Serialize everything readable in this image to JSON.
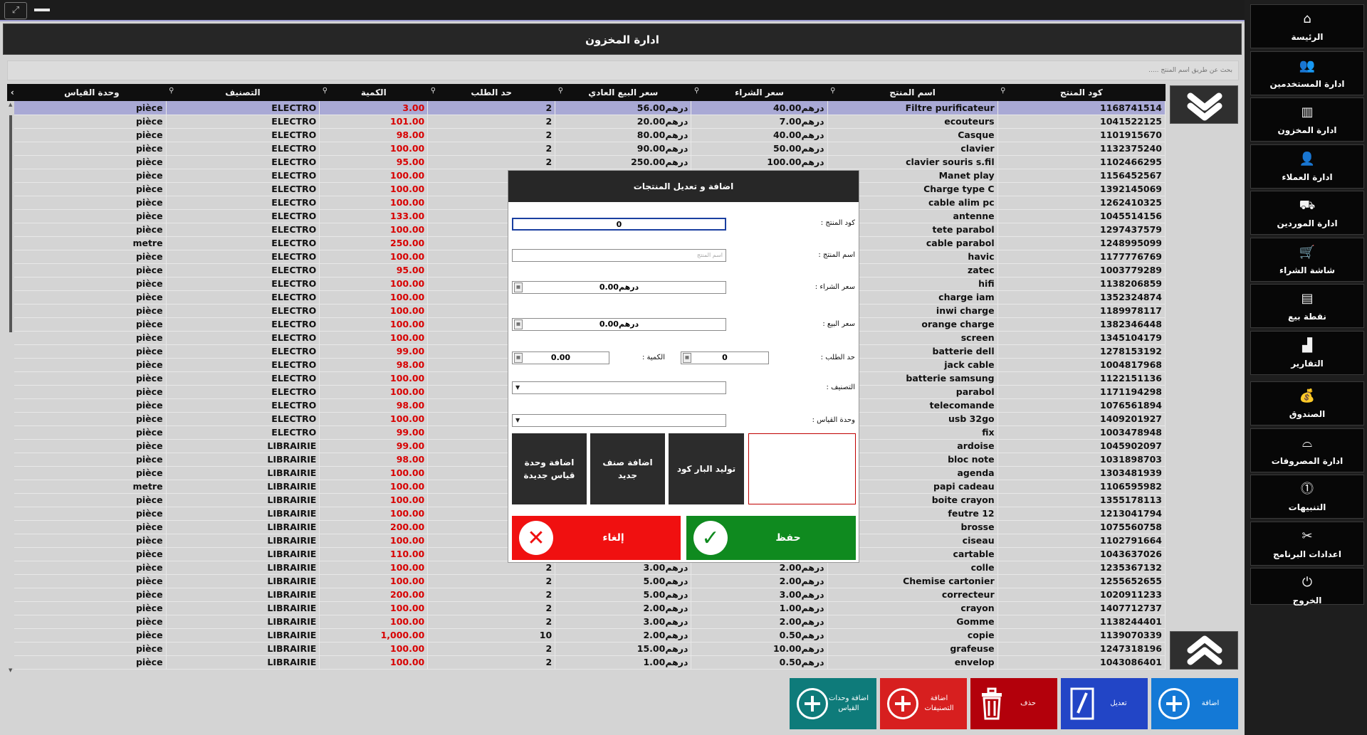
{
  "title": "ادارة المخزون",
  "search": {
    "placeholder": "بحث عن طريق اسم المنتج ....."
  },
  "table": {
    "columns": [
      "كود المنتج",
      "اسم المنتج",
      "سعر الشراء",
      "سعر البيع العادي",
      "حد الطلب",
      "الكمية",
      "التصنيف",
      "وحدة القياس"
    ],
    "currency": "درهم",
    "rows": [
      {
        "code": "1168741514",
        "name": "Filtre purificateur",
        "buy": "40.00",
        "sell": "56.00",
        "order_limit": "2",
        "qty": "3.00",
        "category": "ELECTRO",
        "unit": "pièce"
      },
      {
        "code": "1041522125",
        "name": "ecouteurs",
        "buy": "7.00",
        "sell": "20.00",
        "order_limit": "2",
        "qty": "101.00",
        "category": "ELECTRO",
        "unit": "pièce"
      },
      {
        "code": "1101915670",
        "name": "Casque",
        "buy": "40.00",
        "sell": "80.00",
        "order_limit": "2",
        "qty": "98.00",
        "category": "ELECTRO",
        "unit": "pièce"
      },
      {
        "code": "1132375240",
        "name": "clavier",
        "buy": "50.00",
        "sell": "90.00",
        "order_limit": "2",
        "qty": "100.00",
        "category": "ELECTRO",
        "unit": "pièce"
      },
      {
        "code": "1102466295",
        "name": "clavier souris s.fil",
        "buy": "100.00",
        "sell": "250.00",
        "order_limit": "2",
        "qty": "95.00",
        "category": "ELECTRO",
        "unit": "pièce"
      },
      {
        "code": "1156452567",
        "name": "Manet play",
        "buy": "",
        "sell": "",
        "order_limit": "",
        "qty": "100.00",
        "category": "ELECTRO",
        "unit": "pièce"
      },
      {
        "code": "1392145069",
        "name": "Charge type C",
        "buy": "",
        "sell": "",
        "order_limit": "",
        "qty": "100.00",
        "category": "ELECTRO",
        "unit": "pièce"
      },
      {
        "code": "1262410325",
        "name": "cable alim pc",
        "buy": "",
        "sell": "",
        "order_limit": "",
        "qty": "100.00",
        "category": "ELECTRO",
        "unit": "pièce"
      },
      {
        "code": "1045514156",
        "name": "antenne",
        "buy": "",
        "sell": "",
        "order_limit": "",
        "qty": "133.00",
        "category": "ELECTRO",
        "unit": "pièce"
      },
      {
        "code": "1297437579",
        "name": "tete parabol",
        "buy": "",
        "sell": "",
        "order_limit": "",
        "qty": "100.00",
        "category": "ELECTRO",
        "unit": "pièce"
      },
      {
        "code": "1248995099",
        "name": "cable parabol",
        "buy": "",
        "sell": "",
        "order_limit": "",
        "qty": "250.00",
        "category": "ELECTRO",
        "unit": "metre"
      },
      {
        "code": "1177776769",
        "name": "havic",
        "buy": "",
        "sell": "",
        "order_limit": "",
        "qty": "100.00",
        "category": "ELECTRO",
        "unit": "pièce"
      },
      {
        "code": "1003779289",
        "name": "zatec",
        "buy": "",
        "sell": "",
        "order_limit": "",
        "qty": "95.00",
        "category": "ELECTRO",
        "unit": "pièce"
      },
      {
        "code": "1138206859",
        "name": "hifi",
        "buy": "",
        "sell": "",
        "order_limit": "",
        "qty": "100.00",
        "category": "ELECTRO",
        "unit": "pièce"
      },
      {
        "code": "1352324874",
        "name": "charge iam",
        "buy": "",
        "sell": "",
        "order_limit": "",
        "qty": "100.00",
        "category": "ELECTRO",
        "unit": "pièce"
      },
      {
        "code": "1189978117",
        "name": "inwi charge",
        "buy": "",
        "sell": "",
        "order_limit": "",
        "qty": "100.00",
        "category": "ELECTRO",
        "unit": "pièce"
      },
      {
        "code": "1382346448",
        "name": "orange charge",
        "buy": "",
        "sell": "",
        "order_limit": "",
        "qty": "100.00",
        "category": "ELECTRO",
        "unit": "pièce"
      },
      {
        "code": "1345104179",
        "name": "screen",
        "buy": "",
        "sell": "",
        "order_limit": "",
        "qty": "100.00",
        "category": "ELECTRO",
        "unit": "pièce"
      },
      {
        "code": "1278153192",
        "name": "batterie dell",
        "buy": "",
        "sell": "",
        "order_limit": "",
        "qty": "99.00",
        "category": "ELECTRO",
        "unit": "pièce"
      },
      {
        "code": "1004817968",
        "name": "jack cable",
        "buy": "",
        "sell": "",
        "order_limit": "",
        "qty": "98.00",
        "category": "ELECTRO",
        "unit": "pièce"
      },
      {
        "code": "1122151136",
        "name": "batterie samsung",
        "buy": "",
        "sell": "",
        "order_limit": "",
        "qty": "100.00",
        "category": "ELECTRO",
        "unit": "pièce"
      },
      {
        "code": "1171194298",
        "name": "parabol",
        "buy": "",
        "sell": "",
        "order_limit": "",
        "qty": "100.00",
        "category": "ELECTRO",
        "unit": "pièce"
      },
      {
        "code": "1076561894",
        "name": "telecomande",
        "buy": "",
        "sell": "",
        "order_limit": "",
        "qty": "98.00",
        "category": "ELECTRO",
        "unit": "pièce"
      },
      {
        "code": "1409201927",
        "name": "usb 32go",
        "buy": "",
        "sell": "",
        "order_limit": "",
        "qty": "100.00",
        "category": "ELECTRO",
        "unit": "pièce"
      },
      {
        "code": "1003478948",
        "name": "fix",
        "buy": "",
        "sell": "",
        "order_limit": "",
        "qty": "99.00",
        "category": "ELECTRO",
        "unit": "pièce"
      },
      {
        "code": "1045902097",
        "name": "ardoise",
        "buy": "",
        "sell": "",
        "order_limit": "",
        "qty": "99.00",
        "category": "LIBRAIRIE",
        "unit": "pièce"
      },
      {
        "code": "1031898703",
        "name": "bloc note",
        "buy": "",
        "sell": "",
        "order_limit": "",
        "qty": "98.00",
        "category": "LIBRAIRIE",
        "unit": "pièce"
      },
      {
        "code": "1303481939",
        "name": "agenda",
        "buy": "",
        "sell": "",
        "order_limit": "",
        "qty": "100.00",
        "category": "LIBRAIRIE",
        "unit": "pièce"
      },
      {
        "code": "1106595982",
        "name": "papi cadeau",
        "buy": "",
        "sell": "",
        "order_limit": "",
        "qty": "100.00",
        "category": "LIBRAIRIE",
        "unit": "metre"
      },
      {
        "code": "1355178113",
        "name": "boite crayon",
        "buy": "",
        "sell": "",
        "order_limit": "",
        "qty": "100.00",
        "category": "LIBRAIRIE",
        "unit": "pièce"
      },
      {
        "code": "1213041794",
        "name": "feutre 12",
        "buy": "",
        "sell": "",
        "order_limit": "",
        "qty": "100.00",
        "category": "LIBRAIRIE",
        "unit": "pièce"
      },
      {
        "code": "1075560758",
        "name": "brosse",
        "buy": "",
        "sell": "",
        "order_limit": "",
        "qty": "200.00",
        "category": "LIBRAIRIE",
        "unit": "pièce"
      },
      {
        "code": "1102791664",
        "name": "ciseau",
        "buy": "",
        "sell": "",
        "order_limit": "",
        "qty": "100.00",
        "category": "LIBRAIRIE",
        "unit": "pièce"
      },
      {
        "code": "1043637026",
        "name": "cartable",
        "buy": "",
        "sell": "",
        "order_limit": "",
        "qty": "110.00",
        "category": "LIBRAIRIE",
        "unit": "pièce"
      },
      {
        "code": "1235367132",
        "name": "colle",
        "buy": "2.00",
        "sell": "3.00",
        "order_limit": "2",
        "qty": "100.00",
        "category": "LIBRAIRIE",
        "unit": "pièce"
      },
      {
        "code": "1255652655",
        "name": "Chemise cartonier",
        "buy": "2.00",
        "sell": "5.00",
        "order_limit": "2",
        "qty": "100.00",
        "category": "LIBRAIRIE",
        "unit": "pièce"
      },
      {
        "code": "1020911233",
        "name": "correcteur",
        "buy": "3.00",
        "sell": "5.00",
        "order_limit": "2",
        "qty": "200.00",
        "category": "LIBRAIRIE",
        "unit": "pièce"
      },
      {
        "code": "1407712737",
        "name": "crayon",
        "buy": "1.00",
        "sell": "2.00",
        "order_limit": "2",
        "qty": "100.00",
        "category": "LIBRAIRIE",
        "unit": "pièce"
      },
      {
        "code": "1138244401",
        "name": "Gomme",
        "buy": "2.00",
        "sell": "3.00",
        "order_limit": "2",
        "qty": "100.00",
        "category": "LIBRAIRIE",
        "unit": "pièce"
      },
      {
        "code": "1139070339",
        "name": "copie",
        "buy": "0.50",
        "sell": "2.00",
        "order_limit": "10",
        "qty": "1,000.00",
        "category": "LIBRAIRIE",
        "unit": "pièce"
      },
      {
        "code": "1247318196",
        "name": "grafeuse",
        "buy": "10.00",
        "sell": "15.00",
        "order_limit": "2",
        "qty": "100.00",
        "category": "LIBRAIRIE",
        "unit": "pièce"
      },
      {
        "code": "1043086401",
        "name": "envelop",
        "buy": "0.50",
        "sell": "1.00",
        "order_limit": "2",
        "qty": "100.00",
        "category": "LIBRAIRIE",
        "unit": "pièce"
      }
    ]
  },
  "bottom_buttons": [
    {
      "label": "اضافة وحدات القياس",
      "color": "#0e7b7a"
    },
    {
      "label": "اضافة التصنيفات",
      "color": "#d71f1f"
    },
    {
      "label": "حذف",
      "color": "#b3000b"
    },
    {
      "label": "تعديل",
      "color": "#2245c6"
    },
    {
      "label": "اضافة",
      "color": "#1479d6"
    }
  ],
  "sidebar": [
    {
      "label": "الرئيسة",
      "icon": "home-icon"
    },
    {
      "label": "ادارة المستخدمين",
      "icon": "users-icon"
    },
    {
      "label": "ادارة المخزون",
      "icon": "inventory-icon"
    },
    {
      "label": "ادارة العملاء",
      "icon": "customer-icon"
    },
    {
      "label": "ادارة الموردين",
      "icon": "supplier-icon"
    },
    {
      "label": "شاشة الشراء",
      "icon": "cart-icon"
    },
    {
      "label": "نقطة بيع",
      "icon": "pos-icon"
    },
    {
      "label": "التقارير",
      "icon": "reports-icon"
    },
    {
      "label": "الصندوق",
      "icon": "cashbox-icon"
    },
    {
      "label": "ادارة المصروفات",
      "icon": "expenses-icon"
    },
    {
      "label": "التنبيهات",
      "icon": "alert-icon"
    },
    {
      "label": "اعدادات البرنامج",
      "icon": "settings-icon"
    },
    {
      "label": "الخروج",
      "icon": "power-icon"
    }
  ],
  "modal": {
    "title": "اضافة و تعديل المنتجات",
    "code_label": "كود المنتج :",
    "code_value": "0",
    "name_label": "اسم المنتج :",
    "name_placeholder": "اسم المنتج",
    "buy_label": "سعر الشراء :",
    "buy_value": "0.00درهم",
    "sell_label": "سعر البيع :",
    "sell_value": "0.00درهم",
    "order_limit_label": "حد الطلب :",
    "order_limit_value": "0",
    "qty_label": "الكمية :",
    "qty_value": "0.00",
    "category_label": "التصنيف :",
    "unit_label": "وحدة القياس :",
    "btn_add_unit": "اضافة وحدة قياس جديدة",
    "btn_add_category": "اضافة صنف جديد",
    "btn_barcode": "توليد البار كود",
    "btn_cancel": "إلغاء",
    "btn_save": "حفظ",
    "colors": {
      "cancel": "#f01010",
      "save": "#0f8a1f"
    }
  }
}
